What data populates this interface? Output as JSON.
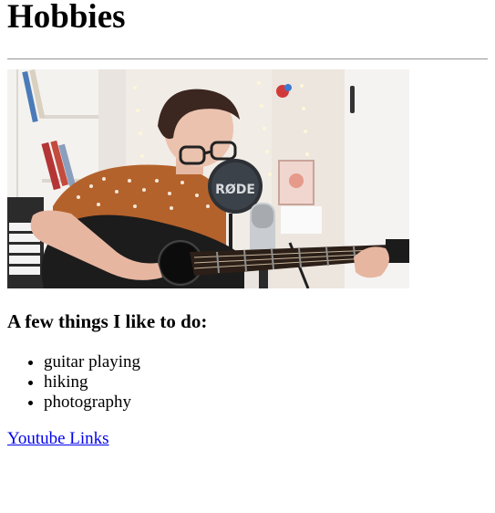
{
  "page": {
    "title": "Hobbies",
    "subheading": "A few things I like to do:",
    "hobbies": [
      "guitar playing",
      "hiking",
      "photography"
    ],
    "link_text": "Youtube Links",
    "photo_mic_brand": "RØDE"
  },
  "colors": {
    "link": "#0000ee",
    "divider": "#a0a0a0"
  }
}
